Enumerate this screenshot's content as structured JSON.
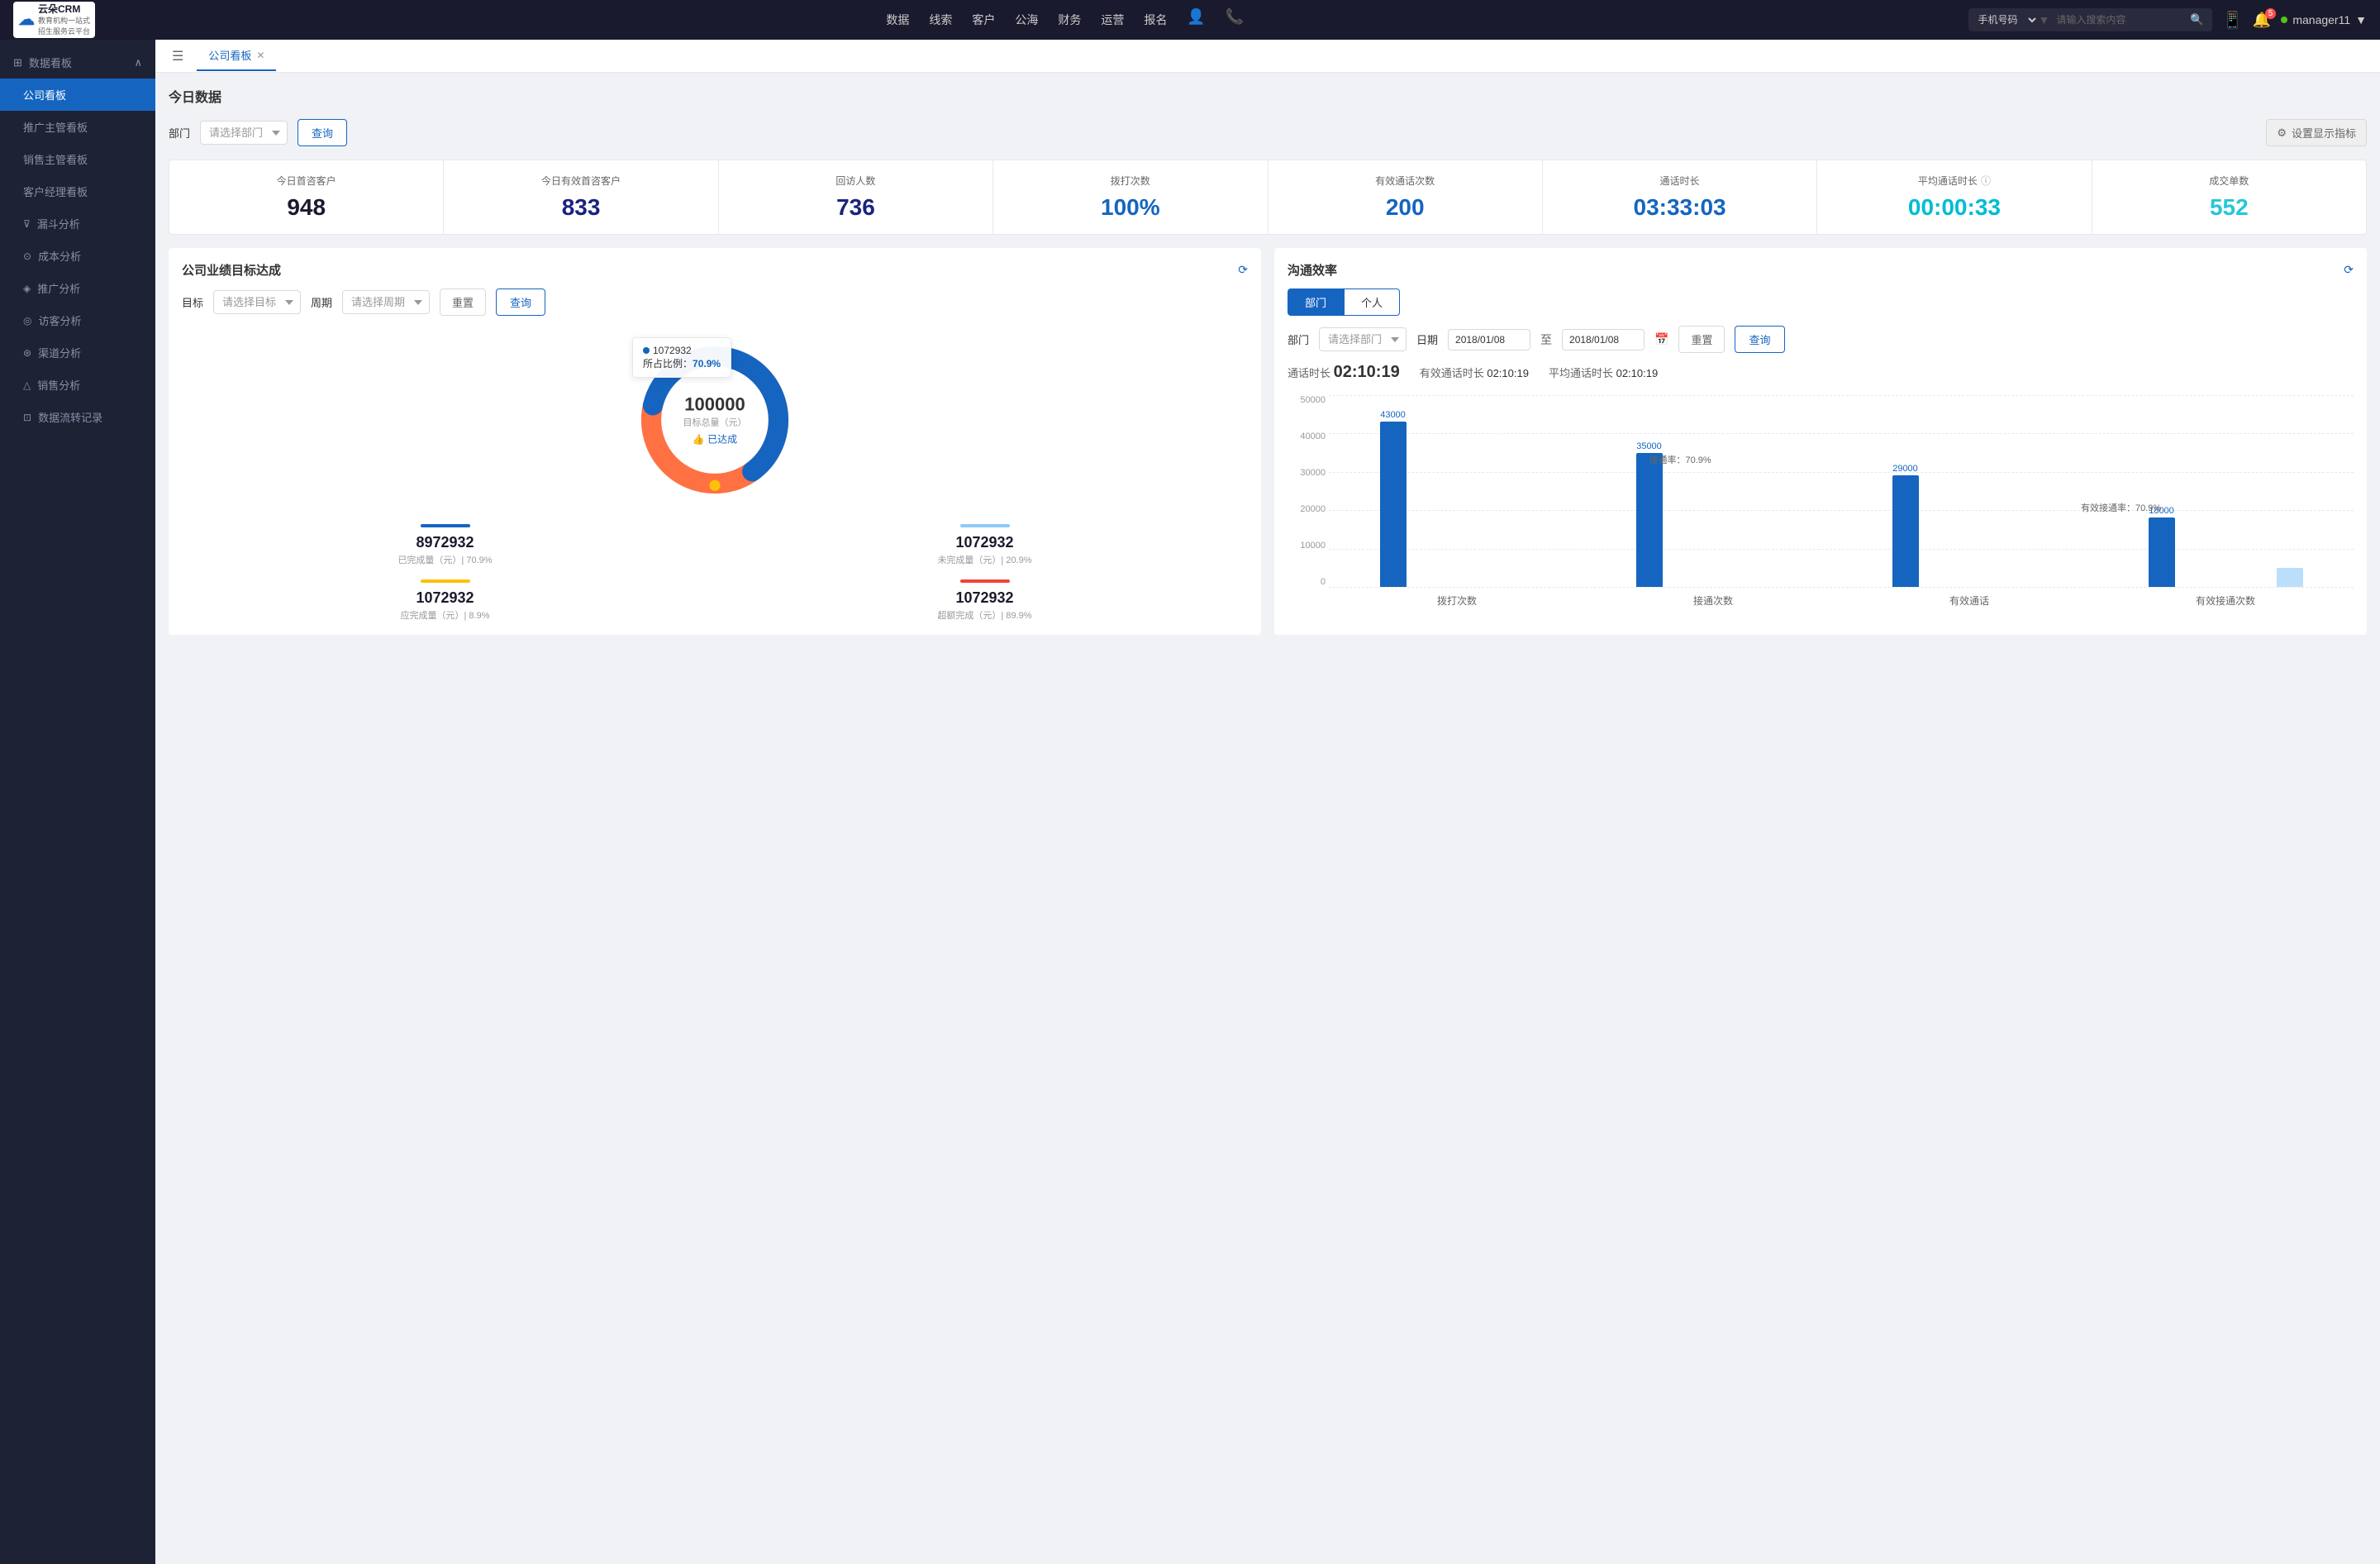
{
  "app": {
    "logo_main": "云朵CRM",
    "logo_sub1": "教育机构一站式",
    "logo_sub2": "招生服务云平台"
  },
  "top_nav": {
    "items": [
      "数据",
      "线索",
      "客户",
      "公海",
      "财务",
      "运营",
      "报名"
    ],
    "search_placeholder": "请输入搜索内容",
    "search_type": "手机号码",
    "user": "manager11",
    "badge_count": "5"
  },
  "sidebar": {
    "section_title": "数据看板",
    "items": [
      {
        "label": "公司看板",
        "active": true
      },
      {
        "label": "推广主管看板",
        "active": false
      },
      {
        "label": "销售主管看板",
        "active": false
      },
      {
        "label": "客户经理看板",
        "active": false
      },
      {
        "label": "漏斗分析",
        "active": false
      },
      {
        "label": "成本分析",
        "active": false
      },
      {
        "label": "推广分析",
        "active": false
      },
      {
        "label": "访客分析",
        "active": false
      },
      {
        "label": "渠道分析",
        "active": false
      },
      {
        "label": "销售分析",
        "active": false
      },
      {
        "label": "数据流转记录",
        "active": false
      }
    ]
  },
  "tabs": {
    "items": [
      {
        "label": "公司看板",
        "active": true
      }
    ]
  },
  "today_data": {
    "title": "今日数据",
    "filter_label": "部门",
    "filter_placeholder": "请选择部门",
    "query_btn": "查询",
    "settings_btn": "设置显示指标",
    "metrics": [
      {
        "label": "今日首咨客户",
        "value": "948",
        "color": "black"
      },
      {
        "label": "今日有效首咨客户",
        "value": "833",
        "color": "blue-dark"
      },
      {
        "label": "回访人数",
        "value": "736",
        "color": "blue-dark"
      },
      {
        "label": "拨打次数",
        "value": "100%",
        "color": "blue"
      },
      {
        "label": "有效通话次数",
        "value": "200",
        "color": "blue"
      },
      {
        "label": "通话时长",
        "value": "03:33:03",
        "color": "blue"
      },
      {
        "label": "平均通话时长",
        "value": "00:00:33",
        "color": "cyan"
      },
      {
        "label": "成交单数",
        "value": "552",
        "color": "teal"
      }
    ]
  },
  "goal_panel": {
    "title": "公司业绩目标达成",
    "goal_label": "目标",
    "goal_placeholder": "请选择目标",
    "period_label": "周期",
    "period_placeholder": "请选择周期",
    "reset_btn": "重置",
    "query_btn": "查询",
    "tooltip_value": "1072932",
    "tooltip_pct_label": "所占比例：",
    "tooltip_pct": "70.9%",
    "donut_center_value": "100000",
    "donut_center_label": "目标总量（元）",
    "donut_achieved": "👍 已达成",
    "stats": [
      {
        "value": "8972932",
        "label": "已完成量（元）| 70.9%",
        "bar_color": "#1565c0"
      },
      {
        "value": "1072932",
        "label": "未完成量（元）| 20.9%",
        "bar_color": "#90caf9"
      },
      {
        "value": "1072932",
        "label": "应完成量（元）| 8.9%",
        "bar_color": "#ffc107"
      },
      {
        "value": "1072932",
        "label": "超额完成（元）| 89.9%",
        "bar_color": "#f44336"
      }
    ]
  },
  "efficiency_panel": {
    "title": "沟通效率",
    "tab_dept": "部门",
    "tab_personal": "个人",
    "dept_label": "部门",
    "dept_placeholder": "请选择部门",
    "date_label": "日期",
    "date_from": "2018/01/08",
    "date_to": "2018/01/08",
    "reset_btn": "重置",
    "query_btn": "查询",
    "total_label": "通话时长",
    "total_value": "02:10:19",
    "effective_label": "有效通话时长",
    "effective_value": "02:10:19",
    "avg_label": "平均通话时长",
    "avg_value": "02:10:19",
    "y_labels": [
      "50000",
      "40000",
      "30000",
      "20000",
      "10000",
      "0"
    ],
    "bars": [
      {
        "label": "拨打次数",
        "groups": [
          {
            "value": 43000,
            "label": "43000",
            "color": "blue",
            "height_pct": 86
          },
          {
            "value": 0,
            "label": "",
            "color": "lightblue",
            "height_pct": 0
          }
        ]
      },
      {
        "label": "接通次数",
        "groups": [
          {
            "value": 35000,
            "label": "35000",
            "color": "blue",
            "height_pct": 70
          },
          {
            "value": 0,
            "label": "",
            "color": "lightblue",
            "height_pct": 0
          }
        ]
      },
      {
        "label": "有效通话",
        "groups": [
          {
            "value": 29000,
            "label": "29000",
            "color": "blue",
            "height_pct": 58
          },
          {
            "value": 0,
            "label": "",
            "color": "lightblue",
            "height_pct": 0
          }
        ]
      },
      {
        "label": "有效接通次数",
        "groups": [
          {
            "value": 18000,
            "label": "18000",
            "color": "blue",
            "height_pct": 36
          },
          {
            "value": 5000,
            "label": "",
            "color": "lightblue",
            "height_pct": 10
          }
        ]
      }
    ],
    "annotation1": "接通率：70.9%",
    "annotation2": "有效接通率：70.9%"
  }
}
